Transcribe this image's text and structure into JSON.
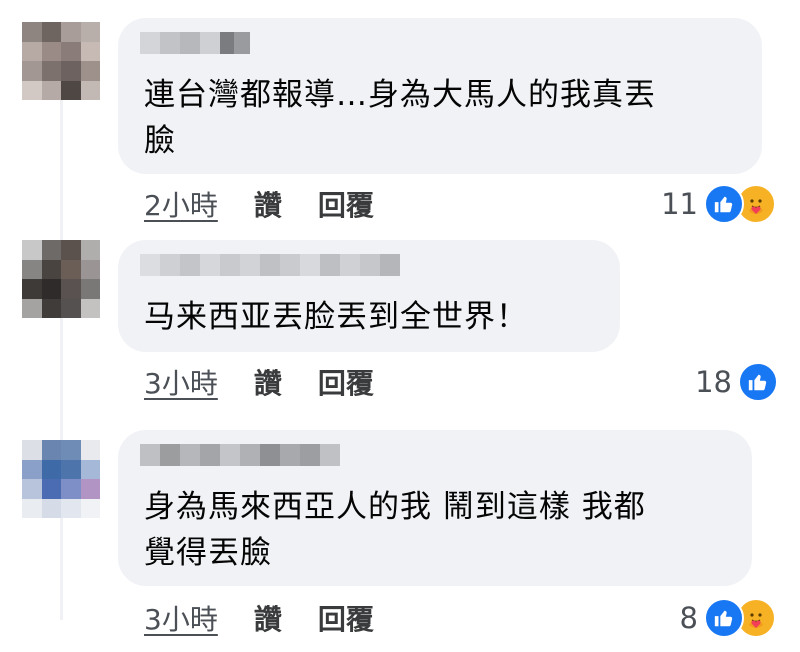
{
  "comments": [
    {
      "text": "連台灣都報導…身為大馬人的我真丟\n臉",
      "time": "2小時",
      "like_label": "讚",
      "reply_label": "回覆",
      "reaction_count": "11",
      "reactions": [
        "like-icon",
        "care-icon"
      ]
    },
    {
      "text": "马来西亚丟脸丟到全世界！",
      "time": "3小時",
      "like_label": "讚",
      "reply_label": "回覆",
      "reaction_count": "18",
      "reactions": [
        "like-icon"
      ]
    },
    {
      "text": "身為馬來西亞人的我 鬧到這樣 我都\n覺得丟臉",
      "time": "3小時",
      "like_label": "讚",
      "reply_label": "回覆",
      "reaction_count": "8",
      "reactions": [
        "like-icon",
        "care-icon"
      ]
    }
  ],
  "colors": {
    "bubble": "#f0f2f5",
    "like": "#1877f2",
    "care": "#f7b125",
    "meta_text": "#4b4f56"
  }
}
